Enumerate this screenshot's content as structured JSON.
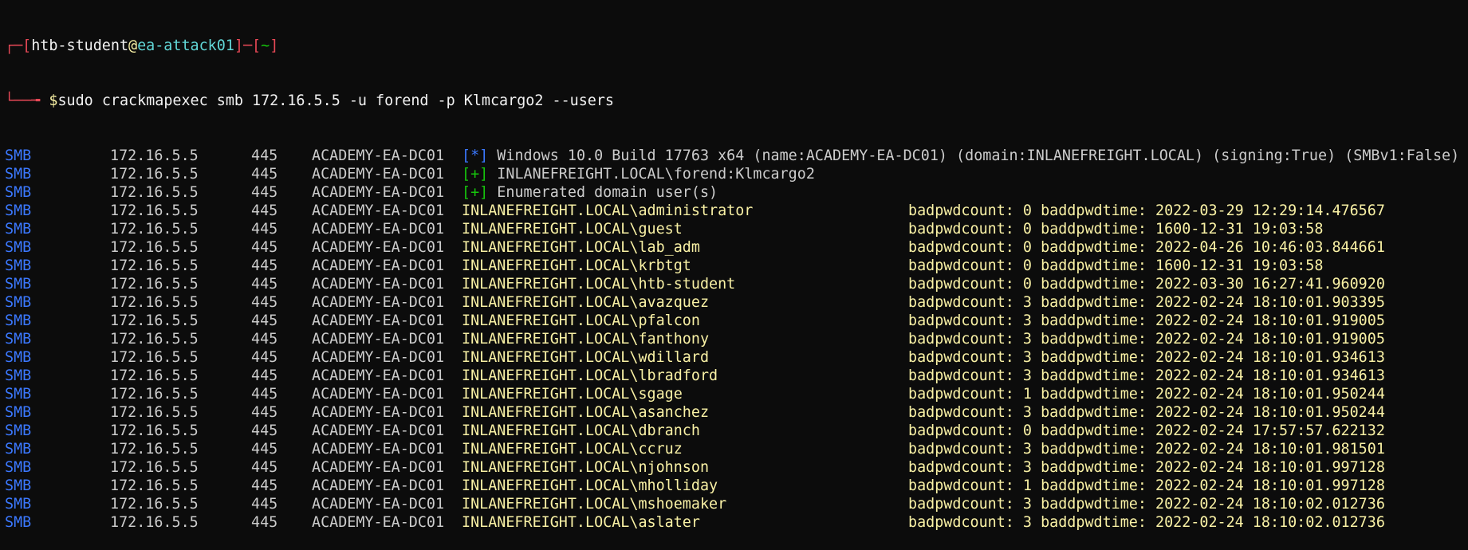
{
  "prompt": {
    "corner_top": "┌─[",
    "user": "htb-student",
    "at": "@",
    "host": "ea-attack01",
    "sep": "]─[",
    "path": "~",
    "close": "]",
    "corner_bottom": "└──╼ ",
    "dollar": "$",
    "command": "sudo crackmapexec smb 172.16.5.5 -u forend -p Klmcargo2 --users"
  },
  "header_rows": [
    {
      "proto": "SMB",
      "ip": "172.16.5.5",
      "port": "445",
      "host": "ACADEMY-EA-DC01",
      "tag": "[*]",
      "tag_color": "blue",
      "text": "Windows 10.0 Build 17763 x64 (name:ACADEMY-EA-DC01) (domain:INLANEFREIGHT.LOCAL) (signing:True) (SMBv1:False)"
    },
    {
      "proto": "SMB",
      "ip": "172.16.5.5",
      "port": "445",
      "host": "ACADEMY-EA-DC01",
      "tag": "[+]",
      "tag_color": "green",
      "text": "INLANEFREIGHT.LOCAL\\forend:Klmcargo2"
    },
    {
      "proto": "SMB",
      "ip": "172.16.5.5",
      "port": "445",
      "host": "ACADEMY-EA-DC01",
      "tag": "[+]",
      "tag_color": "green",
      "text": "Enumerated domain user(s)"
    }
  ],
  "user_rows": [
    {
      "proto": "SMB",
      "ip": "172.16.5.5",
      "port": "445",
      "host": "ACADEMY-EA-DC01",
      "account": "INLANEFREIGHT.LOCAL\\administrator",
      "bad": "badpwdcount: 0 baddpwdtime: 2022-03-29 12:29:14.476567"
    },
    {
      "proto": "SMB",
      "ip": "172.16.5.5",
      "port": "445",
      "host": "ACADEMY-EA-DC01",
      "account": "INLANEFREIGHT.LOCAL\\guest",
      "bad": "badpwdcount: 0 baddpwdtime: 1600-12-31 19:03:58"
    },
    {
      "proto": "SMB",
      "ip": "172.16.5.5",
      "port": "445",
      "host": "ACADEMY-EA-DC01",
      "account": "INLANEFREIGHT.LOCAL\\lab_adm",
      "bad": "badpwdcount: 0 baddpwdtime: 2022-04-26 10:46:03.844661"
    },
    {
      "proto": "SMB",
      "ip": "172.16.5.5",
      "port": "445",
      "host": "ACADEMY-EA-DC01",
      "account": "INLANEFREIGHT.LOCAL\\krbtgt",
      "bad": "badpwdcount: 0 baddpwdtime: 1600-12-31 19:03:58"
    },
    {
      "proto": "SMB",
      "ip": "172.16.5.5",
      "port": "445",
      "host": "ACADEMY-EA-DC01",
      "account": "INLANEFREIGHT.LOCAL\\htb-student",
      "bad": "badpwdcount: 0 baddpwdtime: 2022-03-30 16:27:41.960920"
    },
    {
      "proto": "SMB",
      "ip": "172.16.5.5",
      "port": "445",
      "host": "ACADEMY-EA-DC01",
      "account": "INLANEFREIGHT.LOCAL\\avazquez",
      "bad": "badpwdcount: 3 baddpwdtime: 2022-02-24 18:10:01.903395"
    },
    {
      "proto": "SMB",
      "ip": "172.16.5.5",
      "port": "445",
      "host": "ACADEMY-EA-DC01",
      "account": "INLANEFREIGHT.LOCAL\\pfalcon",
      "bad": "badpwdcount: 3 baddpwdtime: 2022-02-24 18:10:01.919005"
    },
    {
      "proto": "SMB",
      "ip": "172.16.5.5",
      "port": "445",
      "host": "ACADEMY-EA-DC01",
      "account": "INLANEFREIGHT.LOCAL\\fanthony",
      "bad": "badpwdcount: 3 baddpwdtime: 2022-02-24 18:10:01.919005"
    },
    {
      "proto": "SMB",
      "ip": "172.16.5.5",
      "port": "445",
      "host": "ACADEMY-EA-DC01",
      "account": "INLANEFREIGHT.LOCAL\\wdillard",
      "bad": "badpwdcount: 3 baddpwdtime: 2022-02-24 18:10:01.934613"
    },
    {
      "proto": "SMB",
      "ip": "172.16.5.5",
      "port": "445",
      "host": "ACADEMY-EA-DC01",
      "account": "INLANEFREIGHT.LOCAL\\lbradford",
      "bad": "badpwdcount: 3 baddpwdtime: 2022-02-24 18:10:01.934613"
    },
    {
      "proto": "SMB",
      "ip": "172.16.5.5",
      "port": "445",
      "host": "ACADEMY-EA-DC01",
      "account": "INLANEFREIGHT.LOCAL\\sgage",
      "bad": "badpwdcount: 1 baddpwdtime: 2022-02-24 18:10:01.950244"
    },
    {
      "proto": "SMB",
      "ip": "172.16.5.5",
      "port": "445",
      "host": "ACADEMY-EA-DC01",
      "account": "INLANEFREIGHT.LOCAL\\asanchez",
      "bad": "badpwdcount: 3 baddpwdtime: 2022-02-24 18:10:01.950244"
    },
    {
      "proto": "SMB",
      "ip": "172.16.5.5",
      "port": "445",
      "host": "ACADEMY-EA-DC01",
      "account": "INLANEFREIGHT.LOCAL\\dbranch",
      "bad": "badpwdcount: 0 baddpwdtime: 2022-02-24 17:57:57.622132"
    },
    {
      "proto": "SMB",
      "ip": "172.16.5.5",
      "port": "445",
      "host": "ACADEMY-EA-DC01",
      "account": "INLANEFREIGHT.LOCAL\\ccruz",
      "bad": "badpwdcount: 3 baddpwdtime: 2022-02-24 18:10:01.981501"
    },
    {
      "proto": "SMB",
      "ip": "172.16.5.5",
      "port": "445",
      "host": "ACADEMY-EA-DC01",
      "account": "INLANEFREIGHT.LOCAL\\njohnson",
      "bad": "badpwdcount: 3 baddpwdtime: 2022-02-24 18:10:01.997128"
    },
    {
      "proto": "SMB",
      "ip": "172.16.5.5",
      "port": "445",
      "host": "ACADEMY-EA-DC01",
      "account": "INLANEFREIGHT.LOCAL\\mholliday",
      "bad": "badpwdcount: 1 baddpwdtime: 2022-02-24 18:10:01.997128"
    },
    {
      "proto": "SMB",
      "ip": "172.16.5.5",
      "port": "445",
      "host": "ACADEMY-EA-DC01",
      "account": "INLANEFREIGHT.LOCAL\\mshoemaker",
      "bad": "badpwdcount: 3 baddpwdtime: 2022-02-24 18:10:02.012736"
    },
    {
      "proto": "SMB",
      "ip": "172.16.5.5",
      "port": "445",
      "host": "ACADEMY-EA-DC01",
      "account": "INLANEFREIGHT.LOCAL\\aslater",
      "bad": "badpwdcount: 3 baddpwdtime: 2022-02-24 18:10:02.012736"
    }
  ],
  "colors": {
    "background": "#0c0c0c",
    "proto": "#3b78ff",
    "tag_info": "#3b78ff",
    "tag_success": "#16c60c",
    "account": "#f9f1a5",
    "prompt_bracket": "#e74856",
    "prompt_host": "#61d6d6"
  }
}
